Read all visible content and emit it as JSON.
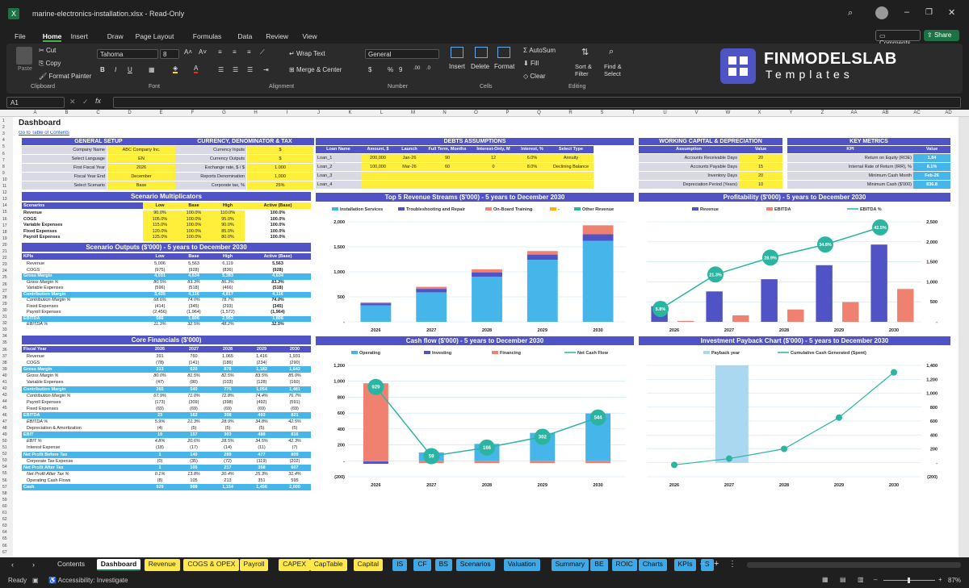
{
  "window": {
    "title": "marine-electronics-installation.xlsx  -  Read-Only"
  },
  "menu": [
    "File",
    "Home",
    "Insert",
    "Draw",
    "Page Layout",
    "Formulas",
    "Data",
    "Review",
    "View"
  ],
  "top_buttons": {
    "comments": "Comments",
    "share": "Share"
  },
  "ribbon": {
    "paste": "Paste",
    "cut": "Cut",
    "copy": "Copy",
    "format_painter": "Format Painter",
    "clipboard": "Clipboard",
    "font_name": "Tahoma",
    "font_size": "8",
    "font": "Font",
    "wrap": "Wrap Text",
    "merge": "Merge & Center",
    "alignment": "Alignment",
    "numfmt": "General",
    "number": "Number",
    "insert": "Insert",
    "delete": "Delete",
    "format": "Format",
    "cells": "Cells",
    "autosum": "AutoSum",
    "fill": "Fill",
    "clear": "Clear",
    "sort": "Sort & Filter",
    "find": "Find & Select",
    "editing": "Editing"
  },
  "logo": {
    "name": "FINMODELSLAB",
    "sub": "Templates"
  },
  "namebox": "A1",
  "sheet": {
    "title": "Dashboard",
    "link": "Go to Table of Contents"
  },
  "columns": [
    "A",
    "B",
    "C",
    "D",
    "E",
    "F",
    "G",
    "H",
    "I",
    "J",
    "K",
    "L",
    "M",
    "N",
    "O",
    "P",
    "Q",
    "R",
    "S",
    "T",
    "U",
    "V",
    "W",
    "X",
    "Y",
    "Z",
    "AA",
    "AB",
    "AC",
    "AD"
  ],
  "general_setup": {
    "title": "GENERAL SETUP",
    "rows": [
      [
        "Company Name",
        "ABC Company Inc."
      ],
      [
        "Select Language",
        "EN"
      ],
      [
        "First Fiscal Year",
        "2026"
      ],
      [
        "Fiscal Year End",
        "December"
      ],
      [
        "Select Scenario",
        "Base"
      ]
    ]
  },
  "currency": {
    "title": "CURRENCY, DENOMINATOR & TAX",
    "rows": [
      [
        "Currency Inputs",
        "$"
      ],
      [
        "Currency Outputs",
        "$"
      ],
      [
        "Exchange rate, $ / $",
        "1.000"
      ],
      [
        "Reports Denomination",
        "1,000"
      ],
      [
        "Corporate tax, %",
        "25%"
      ]
    ]
  },
  "debts": {
    "title": "DEBTS ASSUMPTIONS",
    "headers": [
      "Loan Name",
      "Amount, $",
      "Launch",
      "Full Term, Months",
      "Interest-Only, M",
      "Interest, %",
      "Select Type"
    ],
    "rows": [
      [
        "Loan_1",
        "200,000",
        "Jan-26",
        "90",
        "12",
        "6.0%",
        "Annuity"
      ],
      [
        "Loan_2",
        "100,000",
        "Mar-26",
        "60",
        "0",
        "8.0%",
        "Declining Balance"
      ],
      [
        "Loan_3",
        "",
        "",
        "",
        "",
        "",
        ""
      ],
      [
        "Loan_4",
        "",
        "",
        "",
        "",
        "",
        ""
      ]
    ]
  },
  "wc": {
    "title": "WORKING CAPITAL & DEPRECIATION",
    "headers": [
      "Assumption",
      "Value"
    ],
    "rows": [
      [
        "Accounts Receivable Days",
        "20"
      ],
      [
        "Accounts Payable Days",
        "15"
      ],
      [
        "Inventory Days",
        "20"
      ],
      [
        "Depreciation Period (Years)",
        "10"
      ]
    ]
  },
  "kpis": {
    "title": "KEY METRICS",
    "headers": [
      "KPI",
      "Value"
    ],
    "rows": [
      [
        "Return on Equity (ROE)",
        "1.84"
      ],
      [
        "Internal Rate of Return (IRR), %",
        "8.1%"
      ],
      [
        "Minimum Cash Month",
        "Feb-26"
      ],
      [
        "Minimum Cash ($'000)",
        "836.8"
      ]
    ]
  },
  "scenario_mult": {
    "title": "Scenario Multiplicators",
    "headers": [
      "Scenarios",
      "Low",
      "Base",
      "High",
      "Active (Base)"
    ],
    "rows": [
      [
        "Revenue",
        "90.0%",
        "100.0%",
        "110.0%",
        "100.0%"
      ],
      [
        "COGS",
        "105.0%",
        "100.0%",
        "95.0%",
        "100.0%"
      ],
      [
        "Variable Expenses",
        "115.0%",
        "100.0%",
        "90.0%",
        "100.0%"
      ],
      [
        "Fixed Expenses",
        "120.0%",
        "100.0%",
        "85.0%",
        "100.0%"
      ],
      [
        "Payroll Expenses",
        "125.0%",
        "100.0%",
        "80.0%",
        "100.0%"
      ]
    ]
  },
  "scenario_out": {
    "title": "Scenario Outputs ($'000) - 5 years to December 2030",
    "headers": [
      "KPIs",
      "Low",
      "Base",
      "High",
      "Active (Base)"
    ],
    "rows": [
      [
        "Revenue",
        "5,006",
        "5,563",
        "6,119",
        "5,563"
      ],
      [
        "COGS",
        "(975)",
        "(928)",
        "(836)",
        "(928)"
      ],
      [
        "Gross Margin",
        "4,031",
        "4,634",
        "5,283",
        "4,634"
      ],
      [
        "Gross Margin %",
        "80.5%",
        "83.3%",
        "86.3%",
        "83.3%"
      ],
      [
        "Variable Expenses",
        "(596)",
        "(518)",
        "(466)",
        "(518)"
      ],
      [
        "Contribution Margin",
        "3,435",
        "4,116",
        "4,817",
        "4,116"
      ],
      [
        "Contribution Margin %",
        "68.6%",
        "74.0%",
        "78.7%",
        "74.0%"
      ],
      [
        "Fixed Expenses",
        "(414)",
        "(345)",
        "(293)",
        "(345)"
      ],
      [
        "Payroll Expenses",
        "(2,456)",
        "(1,964)",
        "(1,572)",
        "(1,964)"
      ],
      [
        "EBITDA",
        "566",
        "1,806",
        "2,952",
        "1,806"
      ],
      [
        "EBITDA %",
        "11.3%",
        "32.5%",
        "48.2%",
        "32.5%"
      ]
    ]
  },
  "core": {
    "title": "Core Financials ($'000)",
    "headers": [
      "Fiscal Year",
      "2026",
      "2027",
      "2028",
      "2029",
      "2030"
    ],
    "rows": [
      [
        "Revenue",
        "391",
        "760",
        "1,065",
        "1,416",
        "1,931"
      ],
      [
        "COGS",
        "(78)",
        "(141)",
        "(186)",
        "(234)",
        "(290)"
      ],
      [
        "Gross Margin",
        "313",
        "620",
        "878",
        "1,182",
        "1,642"
      ],
      [
        "Gross Margin %",
        "80.0%",
        "81.5%",
        "82.5%",
        "83.5%",
        "85.0%"
      ],
      [
        "Variable Expenses",
        "(47)",
        "(80)",
        "(103)",
        "(128)",
        "(160)"
      ],
      [
        "Contribution Margin",
        "265",
        "540",
        "775",
        "1,054",
        "1,481"
      ],
      [
        "Contribution Margin %",
        "67.9%",
        "71.0%",
        "72.8%",
        "74.4%",
        "76.7%"
      ],
      [
        "Payroll Expenses",
        "(173)",
        "(309)",
        "(398)",
        "(492)",
        "(591)"
      ],
      [
        "Fixed Expenses",
        "(69)",
        "(69)",
        "(69)",
        "(69)",
        "(69)"
      ],
      [
        "EBITDA",
        "23",
        "162",
        "308",
        "493",
        "821"
      ],
      [
        "EBITDA %",
        "5.9%",
        "21.3%",
        "28.9%",
        "34.8%",
        "42.5%"
      ],
      [
        "Depreciation & Amortization",
        "(4)",
        "(5)",
        "(5)",
        "(5)",
        "(5)"
      ],
      [
        "EBIT",
        "19",
        "157",
        "303",
        "488",
        "816"
      ],
      [
        "EBIT %",
        "4.8%",
        "20.6%",
        "28.5%",
        "34.5%",
        "42.3%"
      ],
      [
        "Interest Expense",
        "(18)",
        "(17)",
        "(14)",
        "(11)",
        "(7)"
      ],
      [
        "Net Profit Before Tax",
        "1",
        "140",
        "289",
        "477",
        "809"
      ],
      [
        "Corporate Tax Expense",
        "(0)",
        "(35)",
        "(72)",
        "(119)",
        "(202)"
      ],
      [
        "Net Profit After Tax",
        "1",
        "105",
        "217",
        "358",
        "607"
      ],
      [
        "Net Profit After Tax %",
        "0.1%",
        "13.8%",
        "20.4%",
        "25.3%",
        "31.4%"
      ],
      [
        "Operating Cash Flows",
        "(8)",
        "105",
        "213",
        "351",
        "595"
      ],
      [
        "Cash",
        "929",
        "988",
        "1,154",
        "1,456",
        "2,000"
      ]
    ]
  },
  "chart_data": [
    {
      "type": "bar",
      "title": "Top 5 Revenue Streams ($'000) - 5 years to December 2030",
      "categories": [
        "2026",
        "2027",
        "2028",
        "2029",
        "2030"
      ],
      "ylim": [
        0,
        2000
      ],
      "yticks": [
        "-",
        "500",
        "1,000",
        "1,500",
        "2,000"
      ],
      "series": [
        {
          "name": "Installation Services",
          "color": "#45b5ea",
          "values": [
            330,
            590,
            900,
            1240,
            1620
          ]
        },
        {
          "name": "Troubleshooting and Repair",
          "color": "#4f53c6",
          "values": [
            40,
            70,
            90,
            105,
            130
          ]
        },
        {
          "name": "On-Board Training",
          "color": "#f08070",
          "values": [
            20,
            40,
            60,
            70,
            180
          ]
        },
        {
          "name": "-",
          "color": "#ffb300",
          "values": [
            0,
            0,
            0,
            0,
            0
          ]
        },
        {
          "name": "Other Revenue",
          "color": "#2bb5a0",
          "values": [
            0,
            0,
            0,
            0,
            0
          ]
        }
      ]
    },
    {
      "type": "bar",
      "title": "Profitability ($'000) - 5 years to December 2030",
      "categories": [
        "2026",
        "2027",
        "2028",
        "2029",
        "2030"
      ],
      "ylim": [
        0,
        2500
      ],
      "yticks": [
        "-",
        "500",
        "1,000",
        "1,500",
        "2,000",
        "2,500"
      ],
      "series": [
        {
          "name": "Revenue",
          "color": "#4f53c6",
          "values": [
            391,
            760,
            1065,
            1416,
            1931
          ]
        },
        {
          "name": "EBITDA",
          "color": "#f08070",
          "values": [
            23,
            162,
            308,
            493,
            821
          ]
        },
        {
          "name": "EBITDA %",
          "color": "#2bb5a0",
          "type": "line",
          "labels": [
            "5.8%",
            "21.3%",
            "28.9%",
            "34.8%",
            "42.5%"
          ],
          "values": [
            5.8,
            21.3,
            28.9,
            34.8,
            42.5
          ]
        }
      ]
    },
    {
      "type": "bar",
      "title": "Cash flow ($'000) - 5 years to December 2030",
      "categories": [
        "2026",
        "2027",
        "2028",
        "2029",
        "2030"
      ],
      "ylim": [
        -200,
        1200
      ],
      "yticks": [
        "(200)",
        "-",
        "200",
        "400",
        "600",
        "800",
        "1,000",
        "1,200"
      ],
      "series": [
        {
          "name": "Operating",
          "color": "#45b5ea",
          "values": [
            -8,
            105,
            213,
            351,
            595
          ]
        },
        {
          "name": "Investing",
          "color": "#4f53c6",
          "values": [
            -30,
            0,
            0,
            0,
            0
          ]
        },
        {
          "name": "Financing",
          "color": "#f08070",
          "values": [
            975,
            -30,
            -30,
            -30,
            -30
          ]
        },
        {
          "name": "Net Cash Flow",
          "color": "#2bb5a0",
          "type": "line",
          "labels": [
            "929",
            "59",
            "166",
            "302",
            "544"
          ],
          "values": [
            929,
            59,
            166,
            302,
            544
          ]
        }
      ]
    },
    {
      "type": "line",
      "title": "Investment Payback Chart ($'000) - 5 years to December 2030",
      "categories": [
        "2026",
        "2027",
        "2028",
        "2029",
        "2030"
      ],
      "ylim": [
        -200,
        1400
      ],
      "yticks": [
        "(200)",
        "-",
        "200",
        "400",
        "600",
        "800",
        "1,000",
        "1,200",
        "1,400"
      ],
      "series": [
        {
          "name": "Payback year",
          "color": "#a9d8f0",
          "type": "bar",
          "values": [
            0,
            1400,
            0,
            0,
            0
          ]
        },
        {
          "name": "Cumulative Cash Generated (Spent)",
          "color": "#2bb5a0",
          "values": [
            -30,
            60,
            200,
            650,
            1300
          ]
        }
      ]
    }
  ],
  "sheet_tabs": [
    [
      "Contents",
      "d"
    ],
    [
      "Dashboard",
      "a"
    ],
    [
      "Revenue",
      "y"
    ],
    [
      "COGS & OPEX",
      "y"
    ],
    [
      "Payroll",
      "y"
    ],
    [
      "CAPEX",
      "y"
    ],
    [
      "CapTable",
      "y"
    ],
    [
      "Capital",
      "y"
    ],
    [
      "IS",
      "b"
    ],
    [
      "CF",
      "b"
    ],
    [
      "BS",
      "b"
    ],
    [
      "Scenarios",
      "b"
    ],
    [
      "Valuation",
      "b"
    ],
    [
      "Summary",
      "b"
    ],
    [
      "BE",
      "b"
    ],
    [
      "ROIC",
      "b"
    ],
    [
      "Charts",
      "b"
    ],
    [
      "KPIs",
      "b"
    ],
    [
      "S",
      "b"
    ]
  ],
  "status": {
    "ready": "Ready",
    "access": "Accessibility: Investigate",
    "zoom": "87%"
  }
}
